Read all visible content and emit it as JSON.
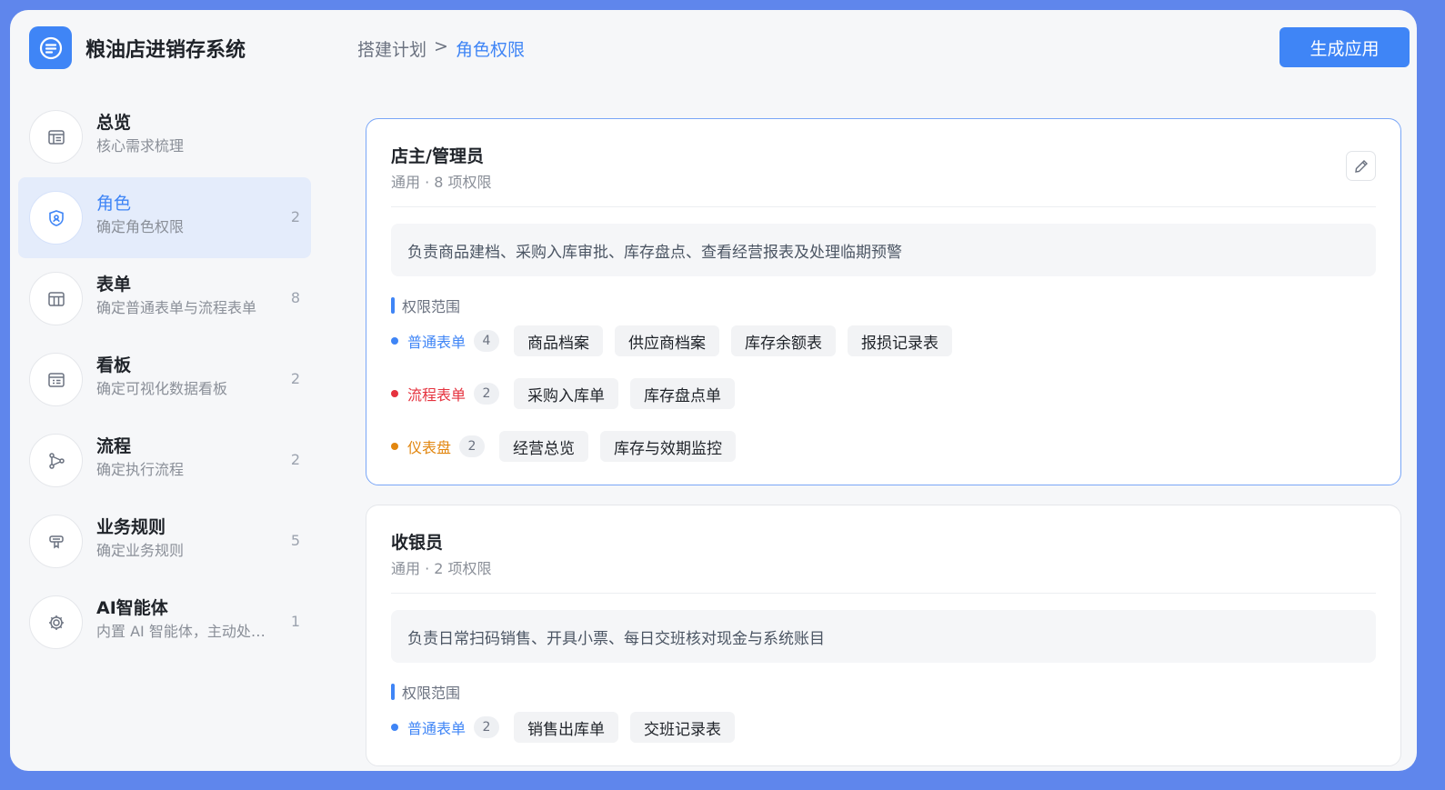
{
  "app": {
    "title": "粮油店进销存系统",
    "generate_label": "生成应用"
  },
  "breadcrumb": {
    "parent": "搭建计划",
    "separator": ">",
    "current": "角色权限"
  },
  "sidebar": {
    "items": [
      {
        "title": "总览",
        "subtitle": "核心需求梳理",
        "count": "",
        "icon": "overview-icon"
      },
      {
        "title": "角色",
        "subtitle": "确定角色权限",
        "count": "2",
        "icon": "role-shield-icon"
      },
      {
        "title": "表单",
        "subtitle": "确定普通表单与流程表单",
        "count": "8",
        "icon": "form-table-icon"
      },
      {
        "title": "看板",
        "subtitle": "确定可视化数据看板",
        "count": "2",
        "icon": "dashboard-icon"
      },
      {
        "title": "流程",
        "subtitle": "确定执行流程",
        "count": "2",
        "icon": "flow-icon"
      },
      {
        "title": "业务规则",
        "subtitle": "确定业务规则",
        "count": "5",
        "icon": "rule-icon"
      },
      {
        "title": "AI智能体",
        "subtitle": "内置 AI 智能体，主动处理业务",
        "count": "1",
        "icon": "ai-gear-icon"
      }
    ]
  },
  "roles": [
    {
      "name": "店主/管理员",
      "meta": "通用 · 8 项权限",
      "description": "负责商品建档、采购入库审批、库存盘点、查看经营报表及处理临期预警",
      "scope_title": "权限范围",
      "categories": [
        {
          "label": "普通表单",
          "count": "4",
          "color": "#3f85f6",
          "tags": [
            "商品档案",
            "供应商档案",
            "库存余额表",
            "报损记录表"
          ]
        },
        {
          "label": "流程表单",
          "count": "2",
          "color": "#e5323e",
          "tags": [
            "采购入库单",
            "库存盘点单"
          ]
        },
        {
          "label": "仪表盘",
          "count": "2",
          "color": "#e2860f",
          "tags": [
            "经营总览",
            "库存与效期监控"
          ]
        }
      ]
    },
    {
      "name": "收银员",
      "meta": "通用 · 2 项权限",
      "description": "负责日常扫码销售、开具小票、每日交班核对现金与系统账目",
      "scope_title": "权限范围",
      "categories": [
        {
          "label": "普通表单",
          "count": "2",
          "color": "#3f85f6",
          "tags": [
            "销售出库单",
            "交班记录表"
          ]
        }
      ]
    }
  ],
  "colors": {
    "accent": "#3f85f6",
    "frame": "#5f86ec",
    "flow_red": "#e5323e",
    "dashboard_orange": "#e2860f"
  }
}
